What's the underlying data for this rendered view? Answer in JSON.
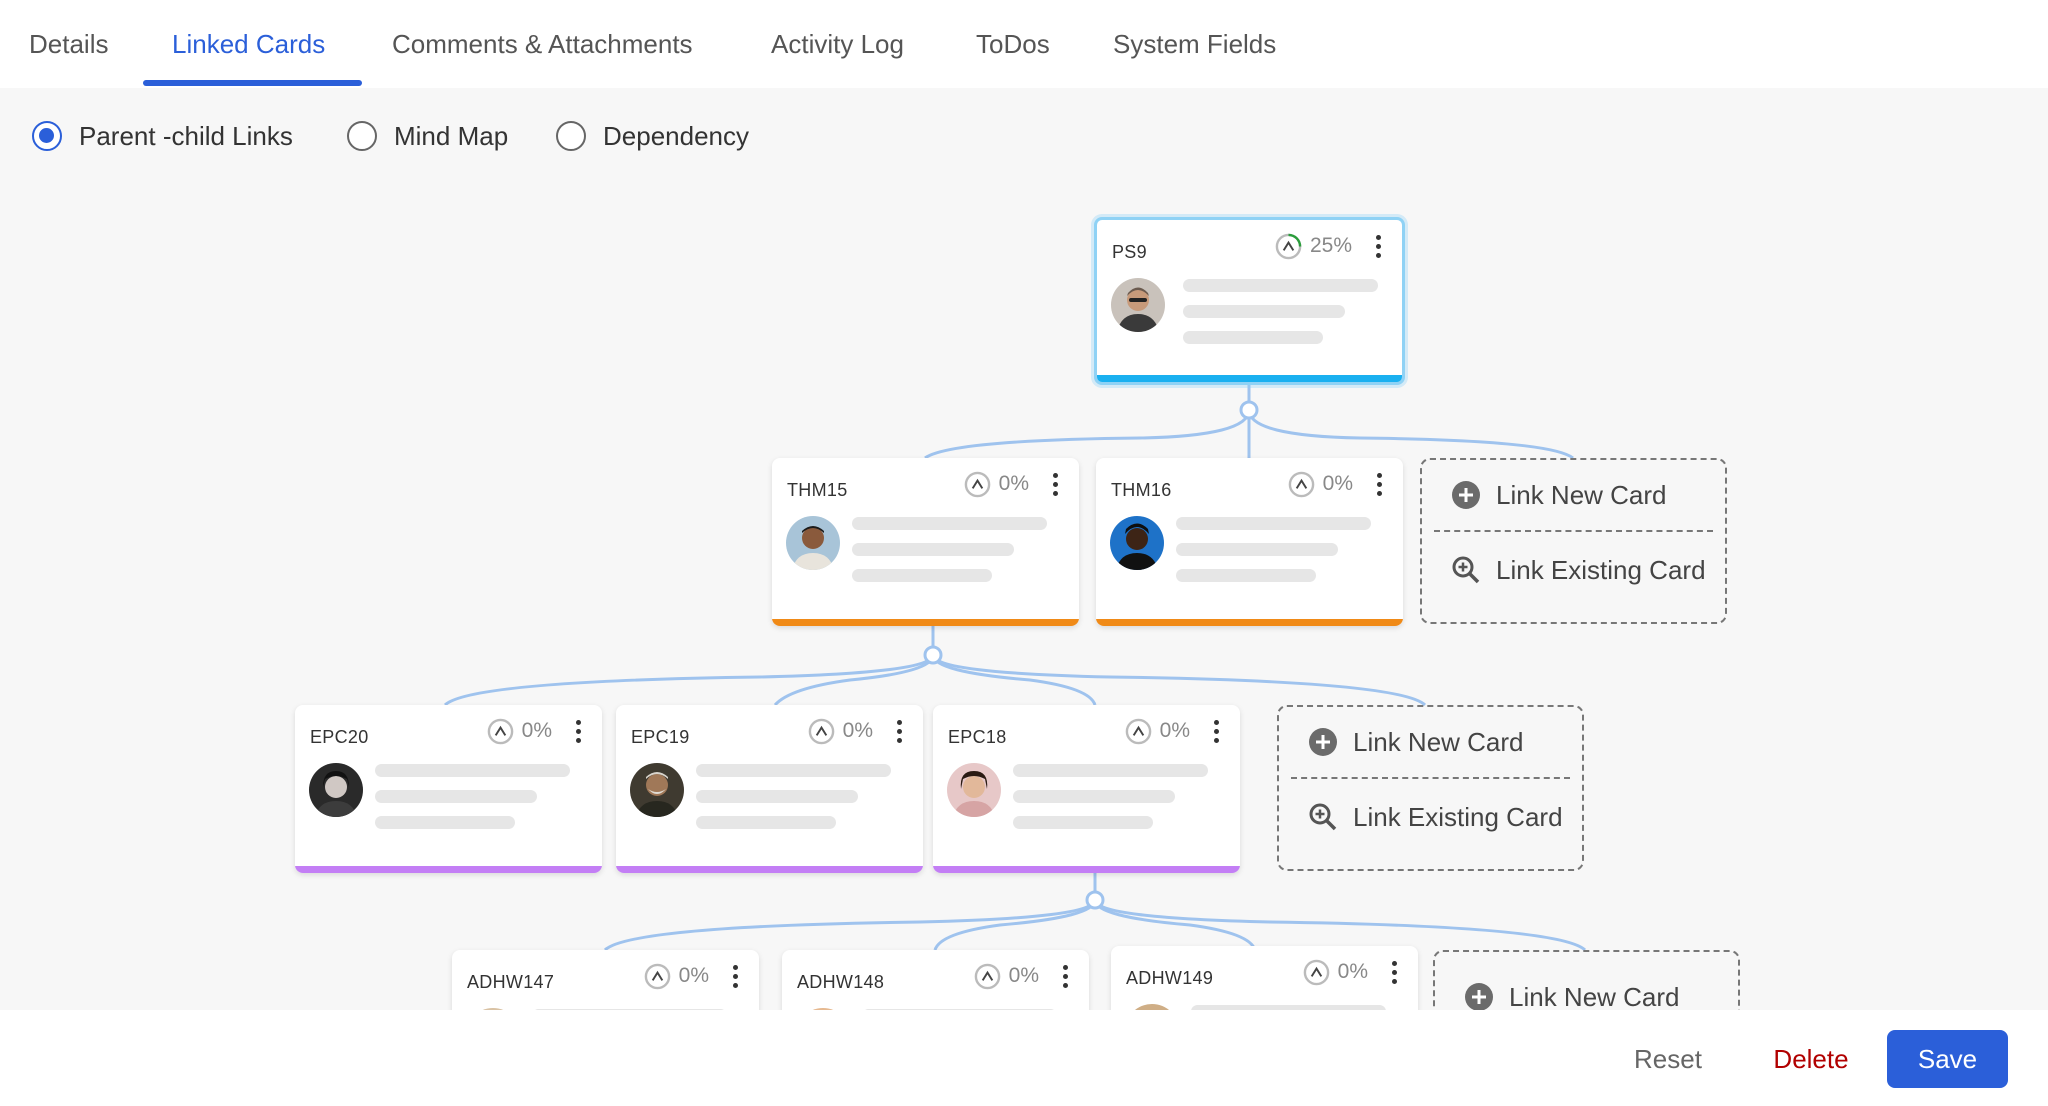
{
  "tabs": [
    {
      "label": "Details"
    },
    {
      "label": "Linked Cards"
    },
    {
      "label": "Comments & Attachments"
    },
    {
      "label": "Activity Log"
    },
    {
      "label": "ToDos"
    },
    {
      "label": "System Fields"
    }
  ],
  "active_tab": "Linked Cards",
  "view_options": [
    {
      "label": "Parent -child Links",
      "checked": true
    },
    {
      "label": "Mind Map",
      "checked": false
    },
    {
      "label": "Dependency",
      "checked": false
    }
  ],
  "cards": {
    "ps9": {
      "code": "PS9",
      "progress": "25%",
      "progress_value": 0.25,
      "bar_color": "#1ab0f0"
    },
    "thm15": {
      "code": "THM15",
      "progress": "0%",
      "progress_value": 0,
      "bar_color": "#f08a17"
    },
    "thm16": {
      "code": "THM16",
      "progress": "0%",
      "progress_value": 0,
      "bar_color": "#f08a17"
    },
    "epc20": {
      "code": "EPC20",
      "progress": "0%",
      "progress_value": 0,
      "bar_color": "#c37ef5"
    },
    "epc19": {
      "code": "EPC19",
      "progress": "0%",
      "progress_value": 0,
      "bar_color": "#c37ef5"
    },
    "epc18": {
      "code": "EPC18",
      "progress": "0%",
      "progress_value": 0,
      "bar_color": "#c37ef5"
    },
    "adhw147": {
      "code": "ADHW147",
      "progress": "0%",
      "progress_value": 0,
      "bar_color": "#c37ef5"
    },
    "adhw148": {
      "code": "ADHW148",
      "progress": "0%",
      "progress_value": 0,
      "bar_color": "#c37ef5"
    },
    "adhw149": {
      "code": "ADHW149",
      "progress": "0%",
      "progress_value": 0,
      "bar_color": "#c37ef5"
    }
  },
  "link_actions": {
    "new_card": "Link New Card",
    "existing_card": "Link Existing Card"
  },
  "footer": {
    "reset": "Reset",
    "delete": "Delete",
    "save": "Save"
  },
  "colors": {
    "accent": "#2b5fd9",
    "connector": "#9fc3ee",
    "delete": "#b10000",
    "progress_ring": "#2a9d3b"
  }
}
